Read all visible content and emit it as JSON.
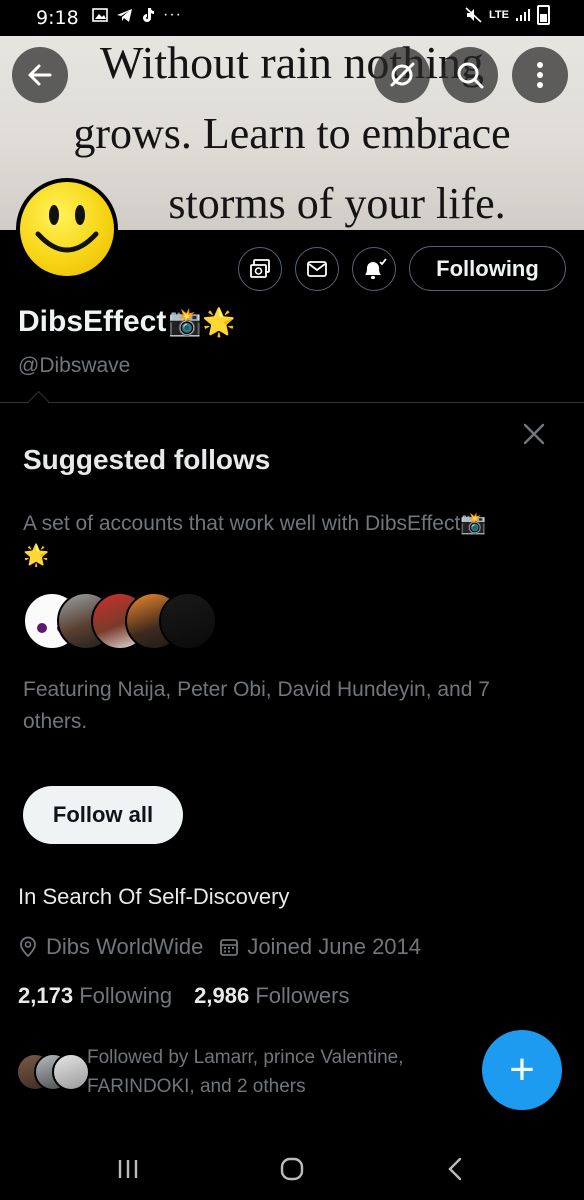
{
  "status_bar": {
    "time": "9:18",
    "network": "LTE"
  },
  "banner": {
    "line1": "Without rain nothing",
    "line2": "grows. Learn to embrace",
    "line3": "storms of your life."
  },
  "profile": {
    "name": "DibsEffect",
    "name_emoji": "📸🌟",
    "handle": "@Dibswave",
    "following_button": "Following",
    "bio": "In Search Of Self-Discovery",
    "location": "Dibs WorldWide",
    "joined": "Joined June 2014",
    "following_count": "2,173",
    "following_label": "Following",
    "followers_count": "2,986",
    "followers_label": "Followers",
    "followed_by": "Followed by Lamarr, prince Valentine, FARINDOKI, and 2 others"
  },
  "suggested": {
    "title": "Suggested follows",
    "description": "A set of accounts that work well with DibsEffect📸🌟",
    "featuring": "Featuring Naija, Peter Obi, David Hundeyin, and 7 others.",
    "follow_all": "Follow all"
  },
  "fab_label": "+",
  "colors": {
    "background": "#000000",
    "text_primary": "#e7e9ea",
    "text_secondary": "#71767b",
    "accent": "#1d9bf0",
    "border": "#536471"
  },
  "icons": [
    "back-arrow-icon",
    "no-signal-icon",
    "search-icon",
    "more-vertical-icon",
    "subscription-icon",
    "message-icon",
    "notification-bell-icon",
    "close-icon",
    "location-pin-icon",
    "calendar-icon",
    "plus-icon",
    "nav-recents-icon",
    "nav-home-icon",
    "nav-back-icon"
  ]
}
